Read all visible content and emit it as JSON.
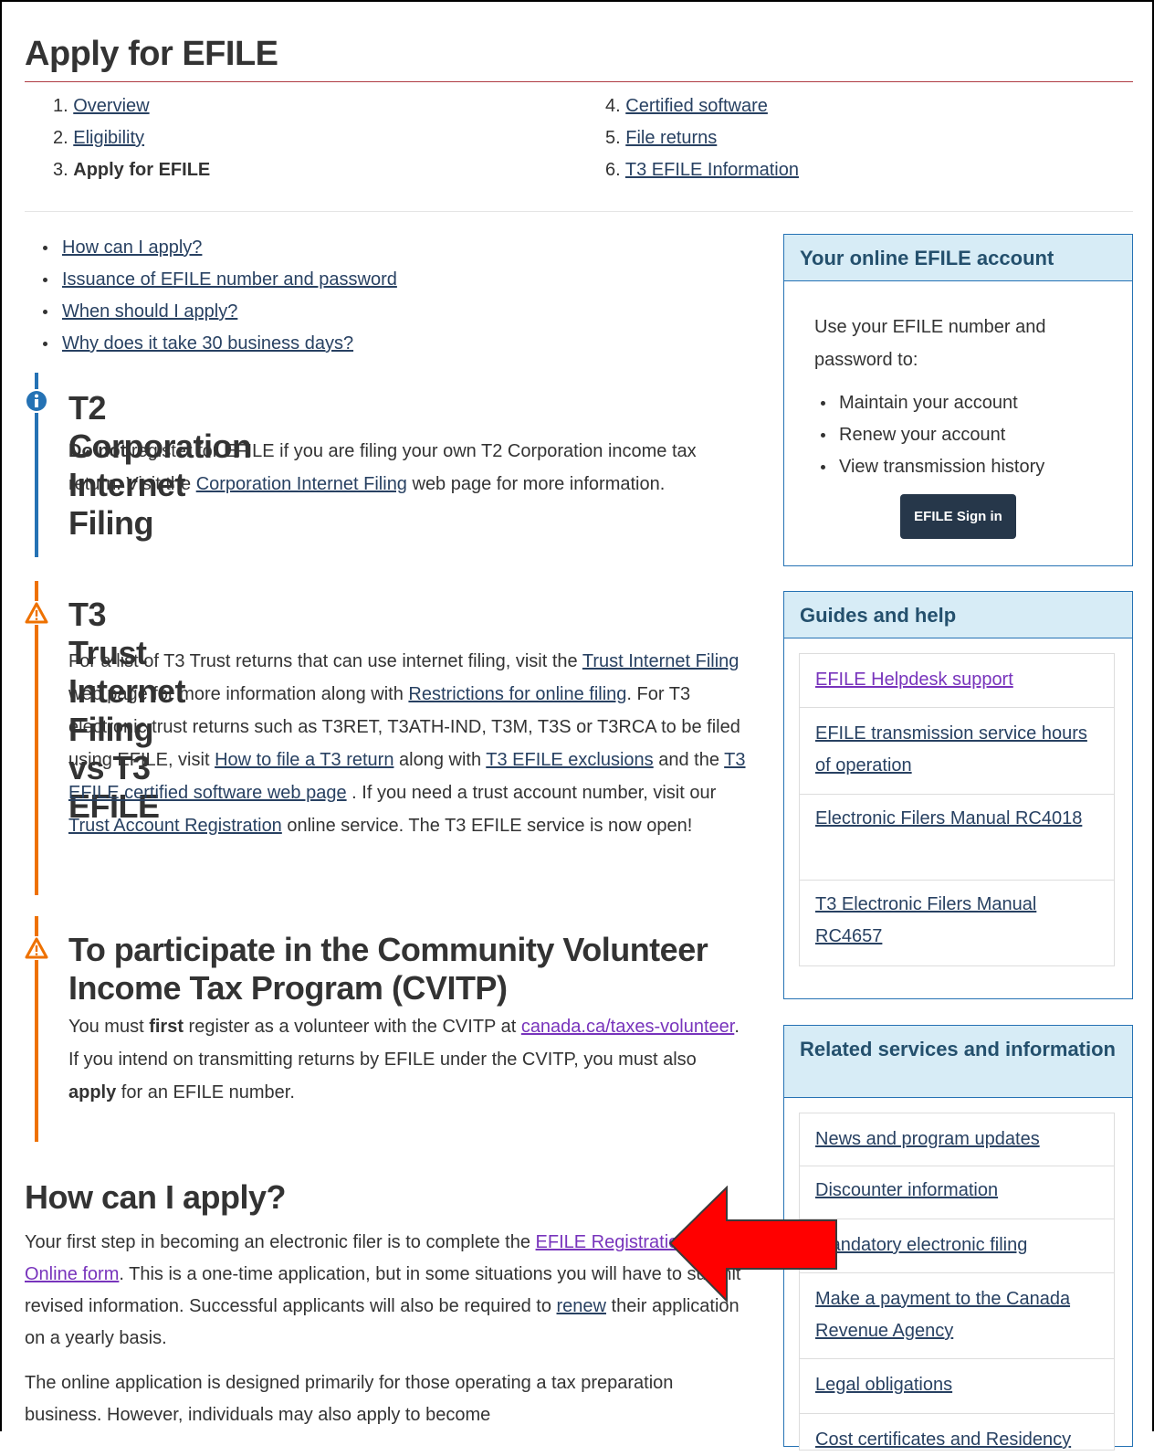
{
  "title": "Apply for EFILE",
  "steps": [
    {
      "num": "1.",
      "label": "Overview"
    },
    {
      "num": "2.",
      "label": "Eligibility"
    },
    {
      "num": "3.",
      "label": "Apply for EFILE"
    },
    {
      "num": "4.",
      "label": "Certified software"
    },
    {
      "num": "5.",
      "label": "File returns"
    },
    {
      "num": "6.",
      "label": "T3 EFILE Information"
    }
  ],
  "toc": [
    "How can I apply?",
    "Issuance of EFILE number and password",
    "When should I apply?",
    "Why does it take 30 business days?"
  ],
  "alert_t2": {
    "heading": "T2 Corporation Internet Filing",
    "bold": "Do not",
    "text1": " register for EFILE if you are filing your own T2 Corporation income tax return. Visit the ",
    "link": "Corporation Internet Filing",
    "text2": " web page for more information."
  },
  "alert_t3": {
    "heading": "T3 Trust Internet Filing vs T3 EFILE",
    "text1": "For a list of T3 Trust returns that can use internet filing, visit the ",
    "link1": "Trust Internet Filing",
    "text2": " web page for more information along with ",
    "link2": "Restrictions for online filing",
    "text3": ". For T3 electronic trust returns such as T3RET, T3ATH-IND, T3M, T3S or T3RCA to be filed using EFILE, visit ",
    "link3": "How to file a T3 return",
    "text4": " along with ",
    "link4": "T3 EFILE exclusions",
    "text5": " and the ",
    "link5": "T3 EFILE certified software web page",
    "text6": " . If you need a trust account number, visit our ",
    "link6": "Trust Account Registration",
    "text7": " online service. The T3 EFILE service is now open!"
  },
  "alert_cvitp": {
    "heading": "To participate in the Community Volunteer Income Tax Program (CVITP)",
    "text1": "You must ",
    "bold1": "first",
    "text2": " register as a volunteer with the CVITP at ",
    "link": "canada.ca/taxes-volunteer",
    "text3": ". If you intend on transmitting returns by EFILE under the CVITP, you must also ",
    "bold2": "apply",
    "text4": " for an EFILE number."
  },
  "how": {
    "heading": "How can I apply?",
    "p1_text1": "Your first step in becoming an electronic filer is to complete the ",
    "p1_link": "EFILE Registration Online form",
    "p1_text2": ". This is a one-time application, but in some situations you will have to submit revised information. Successful applicants will also be required to ",
    "p1_link2": "renew",
    "p1_text3": " their application on a yearly basis.",
    "p2": "The online application is designed primarily for those operating a tax preparation business. However, individuals may also apply to become"
  },
  "account_panel": {
    "heading": "Your online EFILE account",
    "intro": "Use your EFILE number and password to:",
    "items": [
      "Maintain your account",
      "Renew your account",
      "View transmission history"
    ],
    "button": "EFILE Sign in"
  },
  "guides_panel": {
    "heading": "Guides and help",
    "links": [
      "EFILE Helpdesk support",
      "EFILE transmission service hours of operation",
      "Electronic Filers Manual RC4018",
      "T3 Electronic Filers Manual RC4657"
    ]
  },
  "related_panel": {
    "heading": "Related services and information",
    "links": [
      "News and program updates",
      "Discounter information",
      "Mandatory electronic filing",
      "Make a payment to the Canada Revenue Agency",
      "Legal obligations",
      "Cost certificates and Residency"
    ]
  },
  "colors": {
    "link": "#284162",
    "visited": "#7834bc",
    "info_bar": "#2572b4",
    "warning_bar": "#ee7100",
    "panel_header_bg": "#d7ecf6",
    "arrow": "#ff0000",
    "button_bg": "#26374a"
  },
  "icons": {
    "info": "info-circle-icon",
    "warning": "warning-triangle-icon",
    "annotation": "red-arrow-icon"
  }
}
